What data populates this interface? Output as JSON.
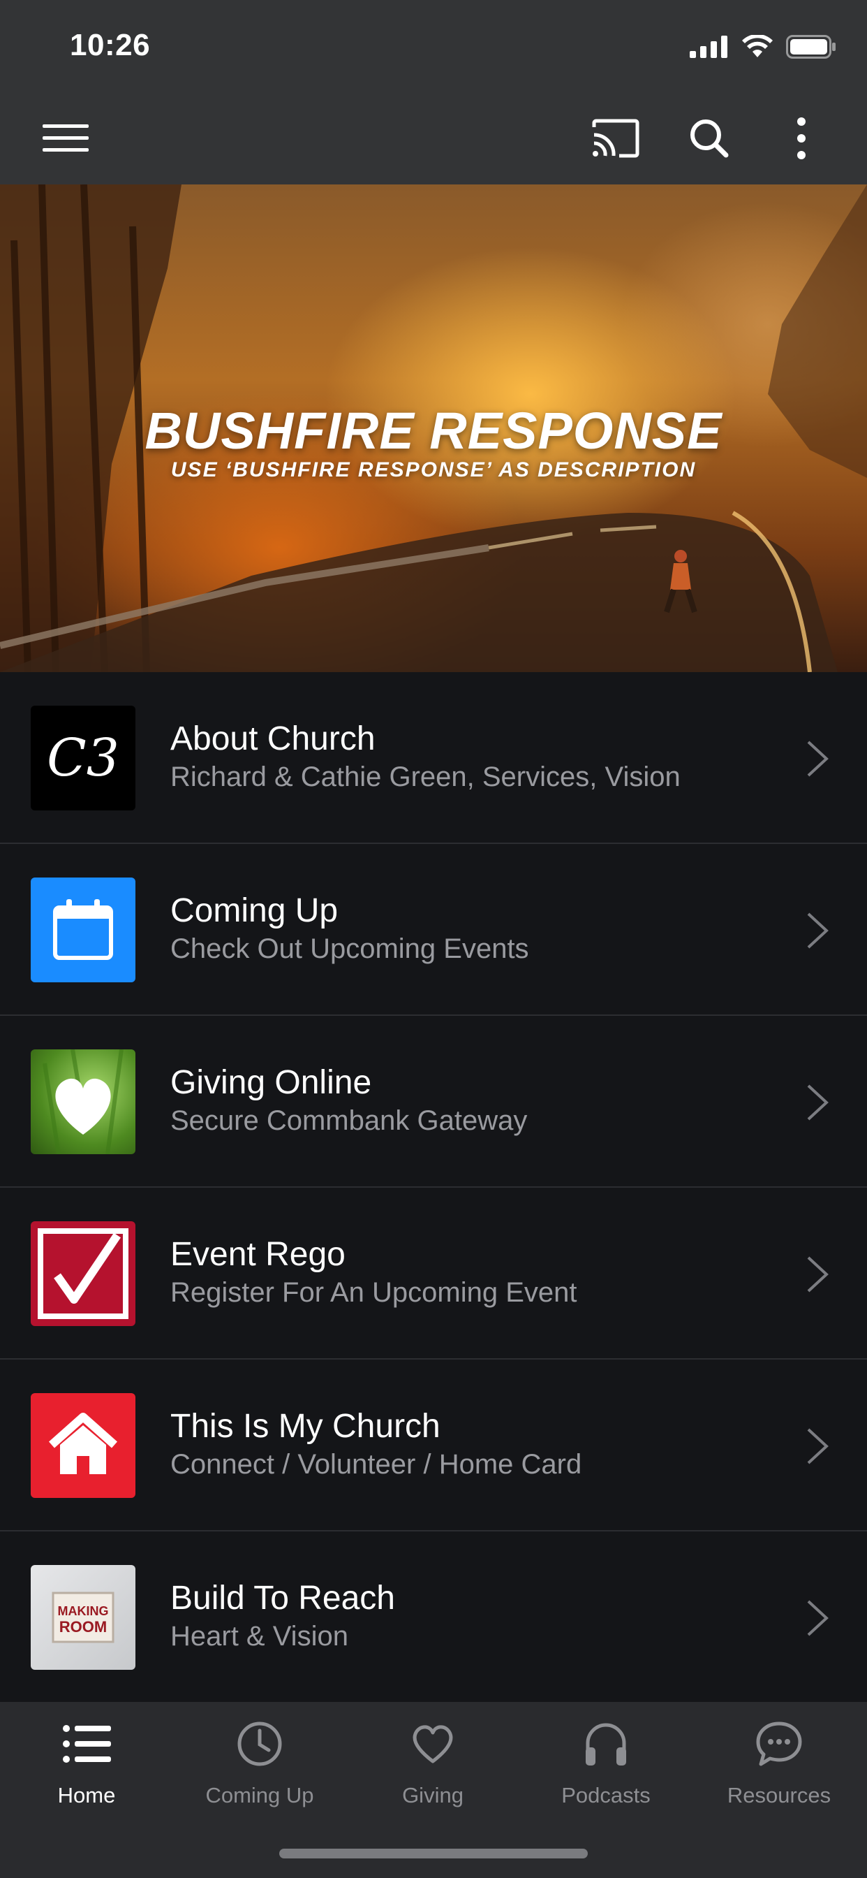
{
  "status_bar": {
    "time": "10:26"
  },
  "app_bar": {
    "menu_icon": "hamburger-menu-icon",
    "cast_icon": "cast-icon",
    "search_icon": "search-icon",
    "more_icon": "more-vertical-icon"
  },
  "hero": {
    "title": "BUSHFIRE RESPONSE",
    "subtitle": "USE ‘BUSHFIRE RESPONSE’ AS DESCRIPTION",
    "slide_count": 5,
    "active_slide": 1
  },
  "menu": {
    "items": [
      {
        "title": "About Church",
        "subtitle": "Richard & Cathie Green, Services, Vision",
        "icon": "c3-logo-icon",
        "thumb_bg": "#000000",
        "logo_text": "C3"
      },
      {
        "title": "Coming Up",
        "subtitle": "Check Out Upcoming Events",
        "icon": "calendar-icon",
        "thumb_bg": "#1a8cff"
      },
      {
        "title": "Giving Online",
        "subtitle": "Secure Commbank Gateway",
        "icon": "heart-icon",
        "thumb_bg": "#5d8f2a"
      },
      {
        "title": "Event Rego",
        "subtitle": "Register For An Upcoming Event",
        "icon": "checkbox-icon",
        "thumb_bg": "#b5122e"
      },
      {
        "title": "This Is My Church",
        "subtitle": "Connect / Volunteer / Home Card",
        "icon": "home-icon",
        "thumb_bg": "#e8202e"
      },
      {
        "title": "Build To Reach",
        "subtitle": "Heart & Vision",
        "icon": "making-room-icon",
        "thumb_bg": "#d9dadc",
        "logo_text_1": "MAKING",
        "logo_text_2": "ROOM"
      }
    ]
  },
  "tabs": [
    {
      "label": "Home",
      "icon": "list-icon",
      "active": true
    },
    {
      "label": "Coming Up",
      "icon": "clock-icon",
      "active": false
    },
    {
      "label": "Giving",
      "icon": "heart-outline-icon",
      "active": false
    },
    {
      "label": "Podcasts",
      "icon": "headphones-icon",
      "active": false
    },
    {
      "label": "Resources",
      "icon": "chat-bubble-icon",
      "active": false
    }
  ],
  "colors": {
    "background": "#141518",
    "bar": "#333436",
    "tab_bar": "#2a2b2e",
    "muted_text": "#9a9ba0"
  }
}
